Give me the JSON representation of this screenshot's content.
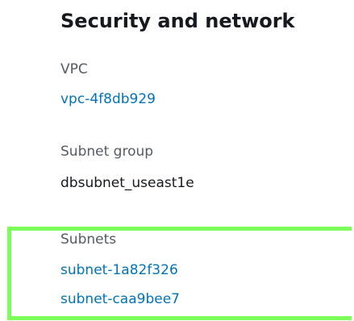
{
  "section": {
    "title": "Security and network"
  },
  "vpc": {
    "label": "VPC",
    "value": "vpc-4f8db929"
  },
  "subnet_group": {
    "label": "Subnet group",
    "value": "dbsubnet_useast1e"
  },
  "subnets": {
    "label": "Subnets",
    "items": [
      "subnet-1a82f326",
      "subnet-caa9bee7"
    ]
  },
  "colors": {
    "link": "#0073bb",
    "label": "#545b64",
    "text": "#16191f",
    "highlight": "#7dff5a"
  }
}
